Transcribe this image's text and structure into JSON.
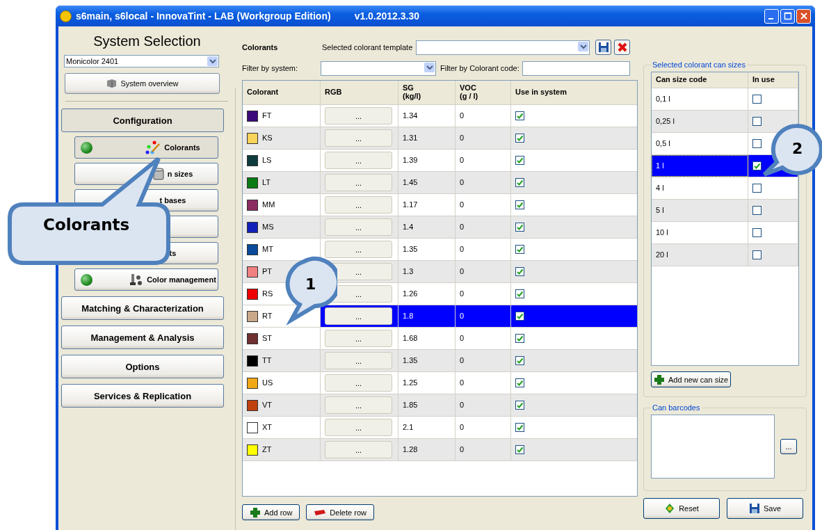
{
  "window": {
    "title": "s6main, s6local - InnovaTint - LAB (Workgroup Edition)",
    "version": "v1.0.2012.3.30"
  },
  "sidebar": {
    "heading": "System Selection",
    "system": "Monicolor 2401",
    "overview_button": "System overview",
    "configuration": {
      "label": "Configuration",
      "expanded": true,
      "items": [
        {
          "label": "Colorants",
          "indicator": true,
          "selected": true
        },
        {
          "label": "n sizes",
          "indicator": false,
          "selected": false
        },
        {
          "label": "t bases",
          "indicator": false,
          "selected": false
        },
        {
          "indicator": false,
          "selected": false
        },
        {
          "label": "ts",
          "indicator": false,
          "selected": false
        },
        {
          "label": "Color management",
          "indicator": true,
          "selected": false
        }
      ]
    },
    "sections": [
      "Matching & Characterization",
      "Management & Analysis",
      "Options",
      "Services & Replication"
    ]
  },
  "colorants": {
    "title": "Colorants",
    "template_label": "Selected colorant template",
    "filter_system_label": "Filter by system:",
    "filter_code_label": "Filter by Colorant code:",
    "columns": [
      "Colorant",
      "RGB",
      "SG\n(kg/l)",
      "VOC\n(g / l)",
      "Use in system"
    ],
    "rows": [
      {
        "code": "FT",
        "color": "#3d0a7a",
        "rgb": "...",
        "sg": "1.34",
        "voc": "0",
        "use": true,
        "selected": false
      },
      {
        "code": "KS",
        "color": "#f9d35a",
        "rgb": "...",
        "sg": "1.31",
        "voc": "0",
        "use": true,
        "selected": false
      },
      {
        "code": "LS",
        "color": "#0e3c3c",
        "rgb": "...",
        "sg": "1.39",
        "voc": "0",
        "use": true,
        "selected": false
      },
      {
        "code": "LT",
        "color": "#0a7a14",
        "rgb": "...",
        "sg": "1.45",
        "voc": "0",
        "use": true,
        "selected": false
      },
      {
        "code": "MM",
        "color": "#8c2d62",
        "rgb": "...",
        "sg": "1.17",
        "voc": "0",
        "use": true,
        "selected": false
      },
      {
        "code": "MS",
        "color": "#1020b8",
        "rgb": "...",
        "sg": "1.4",
        "voc": "0",
        "use": true,
        "selected": false
      },
      {
        "code": "MT",
        "color": "#0a4a9a",
        "rgb": "...",
        "sg": "1.35",
        "voc": "0",
        "use": true,
        "selected": false
      },
      {
        "code": "PT",
        "color": "#f08080",
        "rgb": "...",
        "sg": "1.3",
        "voc": "0",
        "use": true,
        "selected": false
      },
      {
        "code": "RS",
        "color": "#ee0000",
        "rgb": "...",
        "sg": "1.26",
        "voc": "0",
        "use": true,
        "selected": false
      },
      {
        "code": "RT",
        "color": "#c8a888",
        "rgb": "...",
        "sg": "1.8",
        "voc": "0",
        "use": true,
        "selected": true
      },
      {
        "code": "ST",
        "color": "#6e3030",
        "rgb": "...",
        "sg": "1.68",
        "voc": "0",
        "use": true,
        "selected": false
      },
      {
        "code": "TT",
        "color": "#000000",
        "rgb": "...",
        "sg": "1.35",
        "voc": "0",
        "use": true,
        "selected": false
      },
      {
        "code": "US",
        "color": "#f0a818",
        "rgb": "...",
        "sg": "1.25",
        "voc": "0",
        "use": true,
        "selected": false
      },
      {
        "code": "VT",
        "color": "#c04010",
        "rgb": "...",
        "sg": "1.85",
        "voc": "0",
        "use": true,
        "selected": false
      },
      {
        "code": "XT",
        "color": "#ffffff",
        "rgb": "...",
        "sg": "2.1",
        "voc": "0",
        "use": true,
        "selected": false
      },
      {
        "code": "ZT",
        "color": "#ffff00",
        "rgb": "...",
        "sg": "1.28",
        "voc": "0",
        "use": true,
        "selected": false
      }
    ],
    "add_button": "Add row",
    "delete_button": "Delete row"
  },
  "can_sizes": {
    "title": "Selected colorant can sizes",
    "columns": [
      "Can size code",
      "In use"
    ],
    "rows": [
      {
        "code": "0,1 l",
        "in_use": false,
        "selected": false
      },
      {
        "code": "0,25 l",
        "in_use": false,
        "selected": false
      },
      {
        "code": "0,5 l",
        "in_use": false,
        "selected": false
      },
      {
        "code": "1 l",
        "in_use": true,
        "selected": true
      },
      {
        "code": "4 l",
        "in_use": false,
        "selected": false
      },
      {
        "code": "5 l",
        "in_use": false,
        "selected": false
      },
      {
        "code": "10 l",
        "in_use": false,
        "selected": false
      },
      {
        "code": "20 l",
        "in_use": false,
        "selected": false
      }
    ],
    "add_button": "Add new can size"
  },
  "barcodes": {
    "title": "Can barcodes",
    "browse_button": "..."
  },
  "reset_button": "Reset",
  "save_button": "Save",
  "callouts": [
    {
      "kind": "label",
      "text": "Colorants"
    },
    {
      "kind": "number",
      "text": "1"
    },
    {
      "kind": "number",
      "text": "2"
    }
  ]
}
